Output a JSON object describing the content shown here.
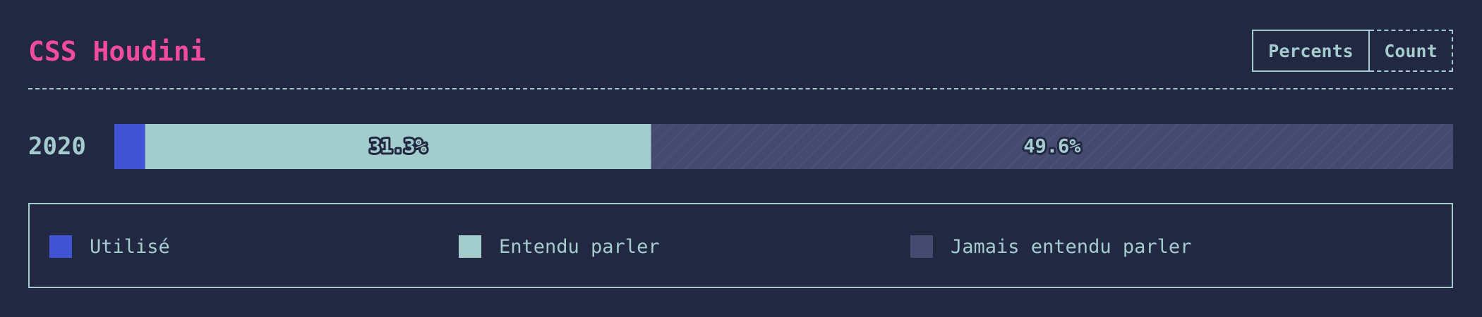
{
  "header": {
    "title": "CSS Houdini",
    "toggle_percents": "Percents",
    "toggle_count": "Count"
  },
  "colors": {
    "background": "#232842",
    "title": "#f04b9c",
    "text": "#a3cccd",
    "used": "#4154d6",
    "heard": "#a3cccd",
    "never_heard": "#454a6e"
  },
  "chart_data": {
    "type": "bar",
    "orientation": "horizontal",
    "stacked": true,
    "categories": [
      "2020"
    ],
    "unit": "%",
    "xlim": [
      0,
      100
    ],
    "series": [
      {
        "name": "Utilisé",
        "values": [
          2.3
        ],
        "color": "#4154d6",
        "value_label": ""
      },
      {
        "name": "Entendu parler",
        "values": [
          37.8
        ],
        "color": "#a3cccd",
        "value_label": "31.3%"
      },
      {
        "name": "Jamais entendu parler",
        "values": [
          59.9
        ],
        "color": "#454a6e",
        "value_label": "49.6%"
      }
    ],
    "legend": {
      "position": "bottom",
      "items": [
        "Utilisé",
        "Entendu parler",
        "Jamais entendu parler"
      ]
    }
  }
}
